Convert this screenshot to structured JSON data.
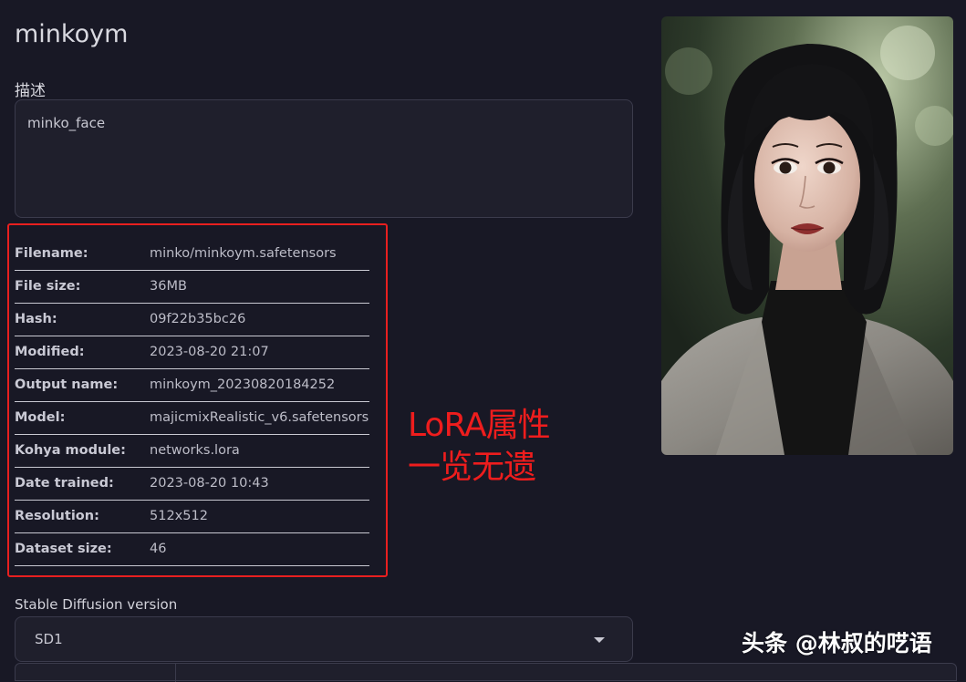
{
  "lora": {
    "title": "minkoym",
    "description_label": "描述",
    "description_value": "minko_face"
  },
  "metadata": [
    {
      "key": "Filename:",
      "value": "minko/minkoym.safetensors"
    },
    {
      "key": "File size:",
      "value": "36MB"
    },
    {
      "key": "Hash:",
      "value": "09f22b35bc26"
    },
    {
      "key": "Modified:",
      "value": "2023-08-20 21:07"
    },
    {
      "key": "Output name:",
      "value": "minkoym_20230820184252"
    },
    {
      "key": "Model:",
      "value": "majicmixRealistic_v6.safetensors"
    },
    {
      "key": "Kohya module:",
      "value": "networks.lora"
    },
    {
      "key": "Date trained:",
      "value": "2023-08-20 10:43"
    },
    {
      "key": "Resolution:",
      "value": "512x512"
    },
    {
      "key": "Dataset size:",
      "value": "46"
    }
  ],
  "annotation": {
    "line1": "LoRA属性",
    "line2": "一览无遗",
    "color": "#ee1d1d"
  },
  "preview_image": {
    "subject": "portrait-photo"
  },
  "sd_version": {
    "label": "Stable Diffusion version",
    "selected": "SD1"
  },
  "watermark": {
    "text": "头条 @林叔的呓语"
  },
  "colors": {
    "background": "#181825",
    "field_background": "#1f1f2c",
    "field_border": "#3b3b4c",
    "highlight_border": "#e81f1f"
  }
}
